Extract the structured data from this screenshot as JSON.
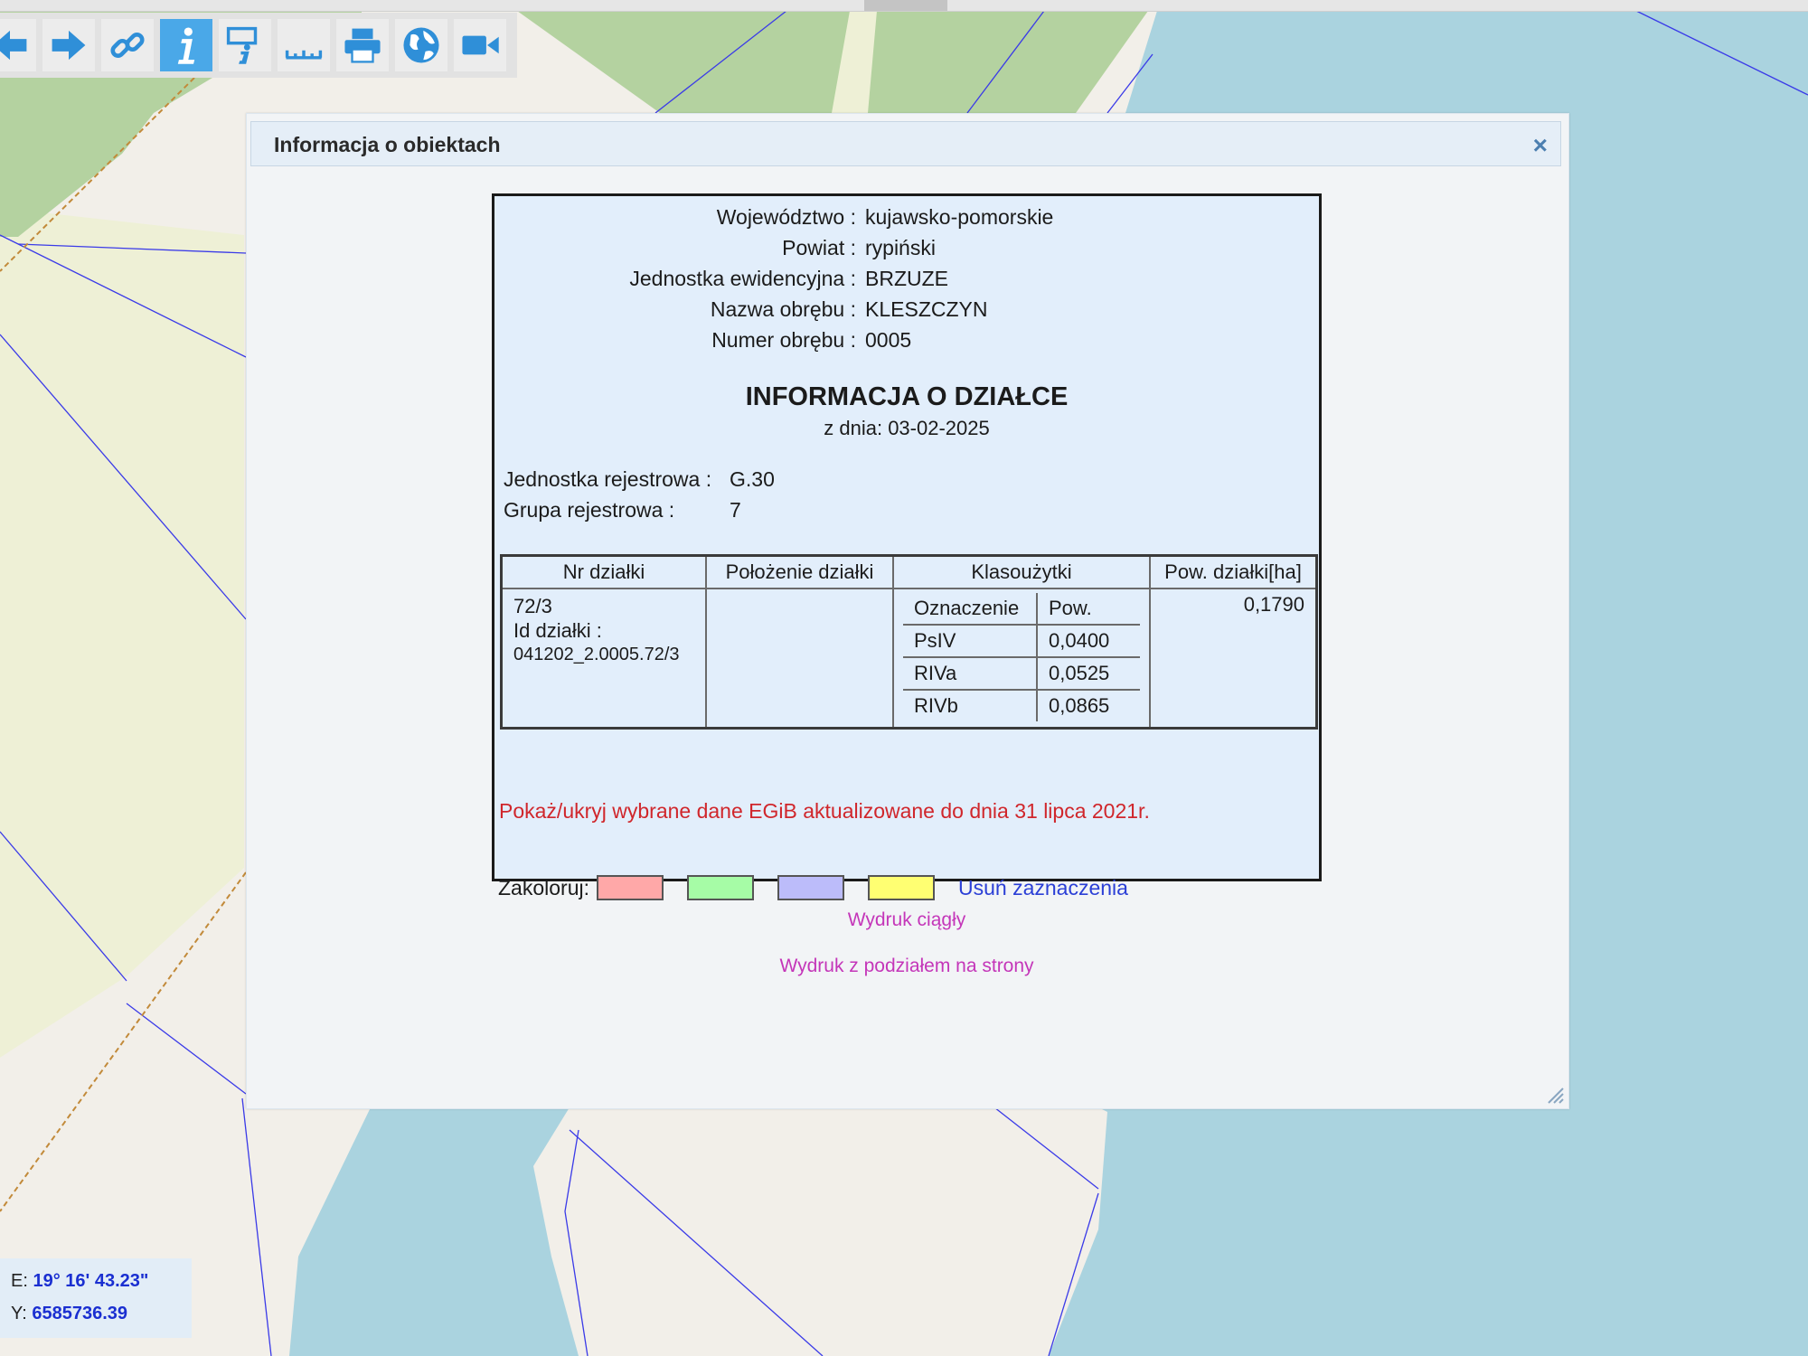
{
  "dialog": {
    "title": "Informacja o obiektach",
    "close_symbol": "×"
  },
  "location": [
    {
      "label": "Województwo :",
      "value": "kujawsko-pomorskie"
    },
    {
      "label": "Powiat :",
      "value": "rypiński"
    },
    {
      "label": "Jednostka ewidencyjna :",
      "value": "BRZUZE"
    },
    {
      "label": "Nazwa obrębu :",
      "value": "KLESZCZYN"
    },
    {
      "label": "Numer obrębu :",
      "value": "0005"
    }
  ],
  "report": {
    "title": "INFORMACJA O DZIAŁCE",
    "date_line": "z dnia: 03-02-2025"
  },
  "register": {
    "unit_label": "Jednostka rejestrowa :",
    "unit_value": "G.30",
    "group_label": "Grupa rejestrowa :",
    "group_value": "7"
  },
  "parcel_table": {
    "headers": [
      "Nr działki",
      "Położenie działki",
      "Klasoużytki",
      "Pow. działki[ha]"
    ],
    "nr": "72/3",
    "id_label": "Id działki :",
    "id_value": "041202_2.0005.72/3",
    "location": "",
    "area": "0,1790",
    "klas_headers": [
      "Oznaczenie",
      "Pow."
    ],
    "klas_rows": [
      {
        "code": "PsIV",
        "area": "0,0400"
      },
      {
        "code": "RIVa",
        "area": "0,0525"
      },
      {
        "code": "RIVb",
        "area": "0,0865"
      }
    ]
  },
  "toggle_link": "Pokaż/ukryj wybrane dane EGiB aktualizowane do dnia 31 lipca 2021r.",
  "colorize": {
    "label": "Zakoloruj:",
    "swatches": [
      "#ffa8a8",
      "#a6fca6",
      "#bcbcfa",
      "#ffff72"
    ],
    "clear_label": "Usuń zaznaczenia"
  },
  "print": {
    "continuous": "Wydruk ciągły",
    "paged": "Wydruk z podziałem na strony"
  },
  "coords": {
    "e_label": "E:",
    "e_value": "19° 16' 43.23\"",
    "y_label": "Y:",
    "y_value": "6585736.39"
  },
  "toolbar": {
    "icons": [
      "arrow-left-icon",
      "arrow-right-icon",
      "link-icon",
      "info-icon",
      "info-tool-icon",
      "ruler-icon",
      "printer-icon",
      "globe-icon",
      "video-camera-icon"
    ],
    "active": "info-icon"
  },
  "colors": {
    "forest": "#b4d2a0",
    "meadow": "#eef0d6",
    "water": "#aad3df",
    "land": "#f2efe9",
    "parcel_line": "#3a3ae8"
  }
}
